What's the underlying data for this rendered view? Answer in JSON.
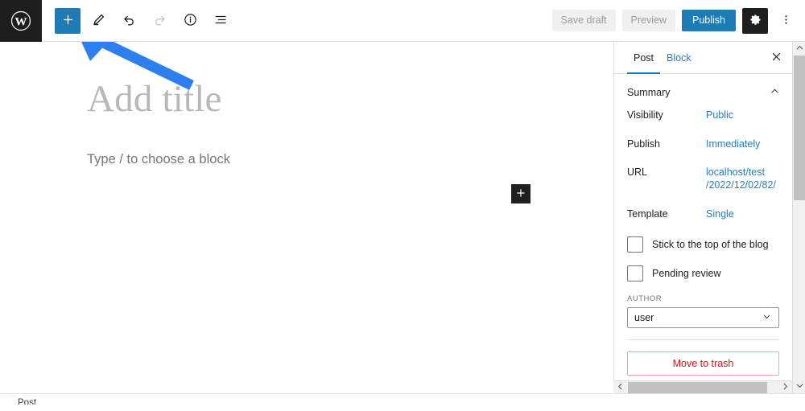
{
  "app": {
    "name": "WordPress Block Editor",
    "logo_icon": "wordpress-logo-icon"
  },
  "toolbar": {
    "left": [
      {
        "name": "block-inserter",
        "icon": "plus-icon",
        "label": "Toggle block inserter",
        "state": "active"
      },
      {
        "name": "tools",
        "icon": "pencil-icon",
        "label": "Tools",
        "state": "enabled"
      },
      {
        "name": "undo",
        "icon": "undo-arrow-icon",
        "label": "Undo",
        "state": "enabled"
      },
      {
        "name": "redo",
        "icon": "redo-arrow-icon",
        "label": "Redo",
        "state": "disabled"
      },
      {
        "name": "details",
        "icon": "info-circle-icon",
        "label": "Details",
        "state": "enabled"
      },
      {
        "name": "list-view",
        "icon": "list-view-icon",
        "label": "List View",
        "state": "enabled"
      }
    ],
    "save_draft_label": "Save draft",
    "preview_label": "Preview",
    "publish_label": "Publish",
    "settings_icon": "gear-icon",
    "options_icon": "ellipsis-vertical-icon"
  },
  "editor": {
    "title_placeholder": "Add title",
    "paragraph_placeholder": "Type / to choose a block",
    "appender_icon": "plus-icon",
    "annotation": {
      "type": "arrow",
      "color": "#2d7ff0",
      "points_to": "block-inserter"
    }
  },
  "sidebar": {
    "tabs": [
      {
        "label": "Post",
        "active": true
      },
      {
        "label": "Block",
        "active": false
      }
    ],
    "close_icon": "close-icon",
    "section": {
      "title": "Summary",
      "expanded": true,
      "chevron_icon": "chevron-up-icon"
    },
    "rows": [
      {
        "label": "Visibility",
        "value": "Public",
        "value_lines": [
          "Public"
        ]
      },
      {
        "label": "Publish",
        "value": "Immediately",
        "value_lines": [
          "Immediately"
        ]
      },
      {
        "label": "URL",
        "value": "localhost/test/2022/12/02/82/",
        "value_lines": [
          "localhost/test",
          "/2022/12/02/82/"
        ]
      },
      {
        "label": "Template",
        "value": "Single",
        "value_lines": [
          "Single"
        ]
      }
    ],
    "checkboxes": [
      {
        "label": "Stick to the top of the blog",
        "checked": false
      },
      {
        "label": "Pending review",
        "checked": false
      }
    ],
    "author": {
      "field_label": "AUTHOR",
      "selected": "user",
      "options": [
        "user"
      ],
      "chevron_icon": "chevron-down-icon"
    },
    "trash_button_label": "Move to trash",
    "trash_button_color": "#cc1818"
  },
  "scrollbars": {
    "vertical": {
      "up_icon": "chevron-up-icon",
      "down_icon": "chevron-down-icon"
    },
    "horizontal": {
      "left_icon": "chevron-left-icon",
      "right_icon": "chevron-right-icon"
    }
  },
  "statusbar": {
    "breadcrumb": "Post"
  },
  "colors": {
    "accent_blue": "#1e7bb5",
    "link_blue": "#2a7fb5",
    "annotation_blue": "#2d7ff0",
    "dark": "#1e1e1e",
    "danger": "#cc1818"
  }
}
